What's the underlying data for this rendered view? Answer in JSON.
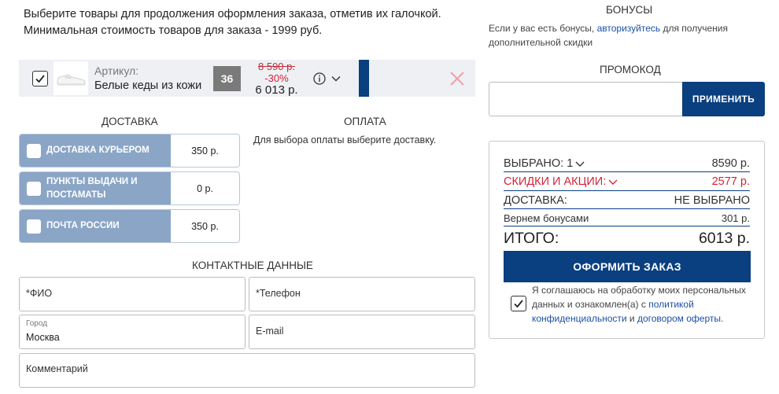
{
  "intro": {
    "line1": "Выберите товары для продолжения оформления заказа, отметив их галочкой.",
    "line2": "Минимальная стоимость товаров для заказа - 1999 руб."
  },
  "product": {
    "article_label": "Артикул:",
    "name": "Белые кеды из кожи",
    "size": "36",
    "old_price": "8 590 р.",
    "discount": "-30%",
    "price": "6 013 р.",
    "checked": true
  },
  "delivery": {
    "title": "ДОСТАВКА",
    "options": [
      {
        "label": "ДОСТАВКА КУРЬЕРОМ",
        "price": "350 р."
      },
      {
        "label_line1": "ПУНКТЫ ВЫДАЧИ И",
        "label_line2": "ПОСТАМАТЫ",
        "price": "0 р."
      },
      {
        "label": "ПОЧТА РОССИИ",
        "price": "350 р."
      }
    ]
  },
  "payment": {
    "title": "ОПЛАТА",
    "note": "Для выбора оплаты выберите доставку."
  },
  "contacts": {
    "title": "КОНТАКТНЫЕ ДАННЫЕ",
    "fio_placeholder": "*ФИО",
    "phone_placeholder": "*Телефон",
    "city_label": "Город",
    "city_value": "Москва",
    "email_placeholder": "E-mail",
    "comment_placeholder": "Комментарий"
  },
  "bonus": {
    "title": "БОНУСЫ",
    "text_before": "Если у вас есть бонусы, ",
    "link": "авторизуйтесь",
    "text_after": " для получения дополнительной скидки"
  },
  "promo": {
    "title": "ПРОМОКОД",
    "input_value": "",
    "apply_label": "ПРИМЕНИТЬ"
  },
  "summary": {
    "selected_label": "ВЫБРАНО: 1",
    "selected_value": "8590 р.",
    "discounts_label": "СКИДКИ И АКЦИИ:",
    "discounts_value": "2577 р.",
    "delivery_label": "ДОСТАВКА:",
    "delivery_value": "НЕ ВЫБРАНО",
    "bonus_label": "Вернем бонусами",
    "bonus_value": "301 р.",
    "total_label": "ИТОГО:",
    "total_value": "6013 р.",
    "order_button": "ОФОРМИТЬ ЗАКАЗ",
    "consent_before": "Я соглашаюсь на обработку моих персональных данных и ознакомлен(а) с ",
    "consent_link1": "политикой конфиденциальности",
    "consent_and": " и ",
    "consent_link2": "договором оферты",
    "consent_end": ".",
    "consent_checked": true
  },
  "colors": {
    "brand_blue": "#0a3f80",
    "option_blue": "#8aa5c6",
    "sale_red": "#d2233a",
    "link_blue": "#1d4fa6"
  }
}
